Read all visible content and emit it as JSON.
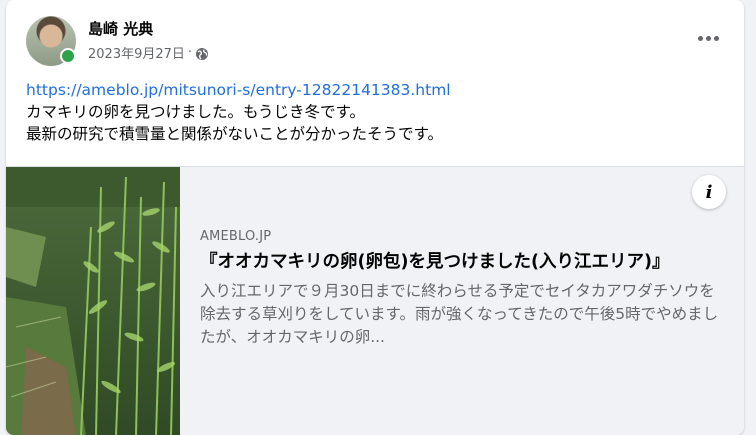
{
  "post": {
    "author": "島崎 光典",
    "timestamp": "2023年9月27日",
    "separator": "·",
    "audience_icon": "globe-icon",
    "more_icon": "more-options-icon",
    "link": "https://ameblo.jp/mitsunori-s/entry-12822141383.html",
    "lines": [
      "カマキリの卵を見つけました。もうじき冬です。",
      "最新の研究で積雪量と関係がないことが分かったそうです。"
    ]
  },
  "preview": {
    "domain": "AMEBLO.JP",
    "title": "『オオカマキリの卵(卵包)を見つけました(入り江エリア)』",
    "description": "入り江エリアで９月30日までに終わらせる予定でセイタカアワダチソウを除去する草刈りをしています。雨が強くなってきたので午後5時でやめましたが、オオカマキリの卵...",
    "info_icon": "info-icon"
  },
  "colors": {
    "link": "#216fdb",
    "online": "#31a24c",
    "secondary_text": "#65676b",
    "preview_bg": "#f0f2f5"
  }
}
